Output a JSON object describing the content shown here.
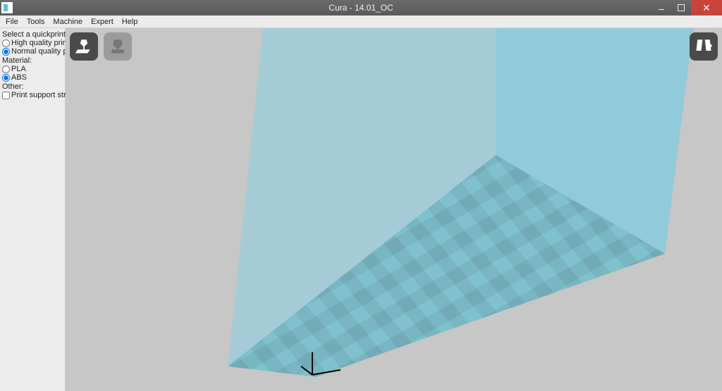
{
  "window": {
    "title": "Cura - 14.01_OC"
  },
  "menu": {
    "file": "File",
    "tools": "Tools",
    "machine": "Machine",
    "expert": "Expert",
    "help": "Help"
  },
  "sidebar": {
    "profile_label": "Select a quickprint profile:",
    "high_quality": "High quality print",
    "normal_quality": "Normal quality print",
    "material_label": "Material:",
    "pla": "PLA",
    "abs": "ABS",
    "other_label": "Other:",
    "support": "Print support structure",
    "selected_profile": "normal",
    "selected_material": "abs",
    "support_checked": false
  },
  "toolbar": {
    "load_icon": "load-model-icon",
    "print_icon": "print-icon",
    "view_icon": "view-mode-icon"
  }
}
